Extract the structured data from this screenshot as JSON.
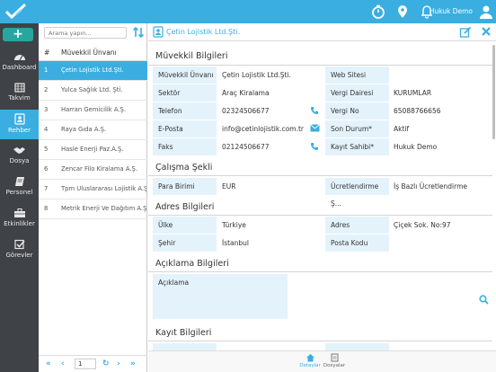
{
  "topbar": {
    "user_name": "Hukuk Demo",
    "icons": [
      "logo-icon",
      "timer-icon",
      "location-icon",
      "bell-icon",
      "user-icon"
    ],
    "accent": "#3aaee0"
  },
  "leftnav": {
    "add_label": "+",
    "items": [
      {
        "label": "Dashboard",
        "icon": "dashboard-icon"
      },
      {
        "label": "Takvim",
        "icon": "calendar-icon"
      },
      {
        "label": "Rehber",
        "icon": "contacts-icon"
      },
      {
        "label": "Dosya",
        "icon": "handshake-icon"
      },
      {
        "label": "Personel",
        "icon": "book-icon"
      },
      {
        "label": "Etkinlikler",
        "icon": "toolbox-icon"
      },
      {
        "label": "Görevler",
        "icon": "checkbox-icon"
      }
    ]
  },
  "list": {
    "search_placeholder": "Arama yapın...",
    "col_num": "#",
    "col_name": "Müvekkil Ünvanı",
    "rows": [
      {
        "num": "1",
        "name": "Çetin Lojistik Ltd.Şti."
      },
      {
        "num": "2",
        "name": "Yulca Sağlık Ltd. Şti."
      },
      {
        "num": "3",
        "name": "Harran Gemicilik A.Ş."
      },
      {
        "num": "4",
        "name": "Raya Gıda A.Ş."
      },
      {
        "num": "5",
        "name": "Hasle Enerji Paz.A.Ş."
      },
      {
        "num": "6",
        "name": "Zencar Filo Kiralama A.Ş."
      },
      {
        "num": "7",
        "name": "Tpm Uluslararası Lojistik A.Ş."
      },
      {
        "num": "8",
        "name": "Metrik Enerji Ve Dağıtım A.Ş."
      }
    ],
    "page": "1"
  },
  "detail": {
    "title": "Çetin Lojistik Ltd.Şti.",
    "sections": {
      "muvekkil": "Müvekkil Bilgileri",
      "calisma": "Çalışma Şekli",
      "adres": "Adres Bilgileri",
      "aciklama": "Açıklama Bilgileri",
      "kayit": "Kayıt Bilgileri"
    },
    "fields": {
      "unvan_l": "Müvekkil Ünvanı",
      "unvan_v": "Çetin Lojistik Ltd.Şti.",
      "web_l": "Web Sitesi",
      "web_v": "",
      "sektor_l": "Sektör",
      "sektor_v": "Araç Kiralama",
      "vd_l": "Vergi Dairesi",
      "vd_v": "KURUMLAR",
      "tel_l": "Telefon",
      "tel_v": "02324506677",
      "vno_l": "Vergi No",
      "vno_v": "65088766656",
      "eposta_l": "E-Posta",
      "eposta_v": "info@cetinlojistik.com.tr",
      "durum_l": "Son Durum*",
      "durum_v": "Aktif",
      "faks_l": "Faks",
      "faks_v": "02124506677",
      "ks_l": "Kayıt Sahibi*",
      "ks_v": "Hukuk Demo",
      "pb_l": "Para Birimi",
      "pb_v": "EUR",
      "us_l": "Ücretlendirme Ş...",
      "us_v": "İş Bazlı Ücretlendirme",
      "ulke_l": "Ülke",
      "ulke_v": "Türkiye",
      "adres_l": "Adres",
      "adres_v": "Çiçek Sok. No:97",
      "sehir_l": "Şehir",
      "sehir_v": "İstanbul",
      "pk_l": "Posta Kodu",
      "pk_v": "",
      "aciklama_l": "Açıklama"
    }
  },
  "bottombar": {
    "tabs": [
      {
        "label": "Detaylar",
        "icon": "home-icon"
      },
      {
        "label": "Dosyalar",
        "icon": "files-icon"
      }
    ]
  }
}
